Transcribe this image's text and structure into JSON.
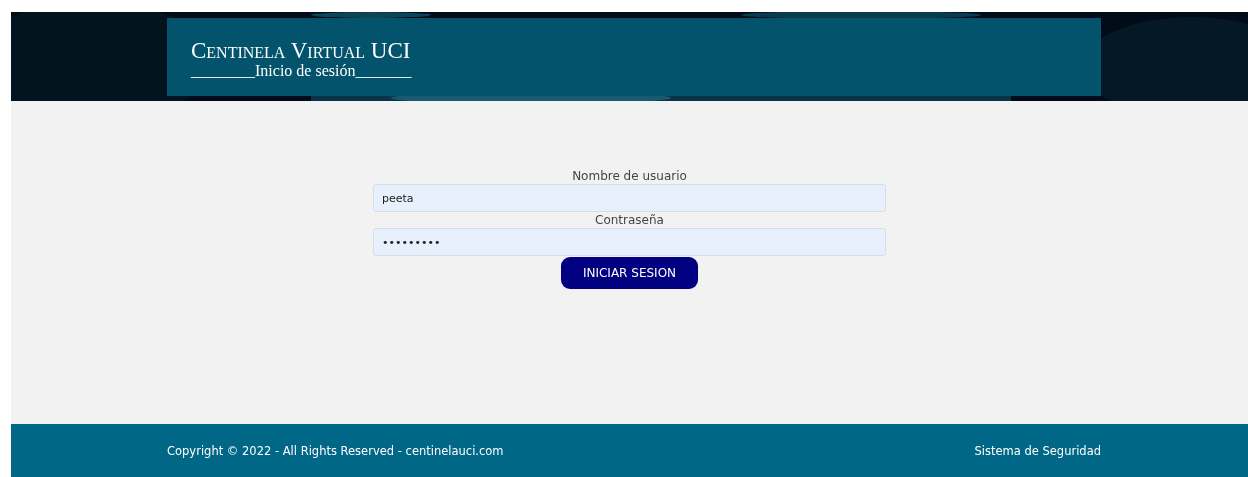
{
  "header": {
    "title": "Centinela Virtual UCI",
    "subtitle": "________Inicio de sesión_______"
  },
  "login_form": {
    "fields": [
      {
        "label": "Nombre de usuario",
        "value": "peeta"
      },
      {
        "label": "Contraseña",
        "value": "•••••••••"
      }
    ],
    "submit_button": "INICIAR SESION"
  },
  "footer": {
    "copyright": "Copyright © 2022 - All Rights Reserved - centinelauci.com",
    "tagline": "Sistema de Seguridad"
  }
}
